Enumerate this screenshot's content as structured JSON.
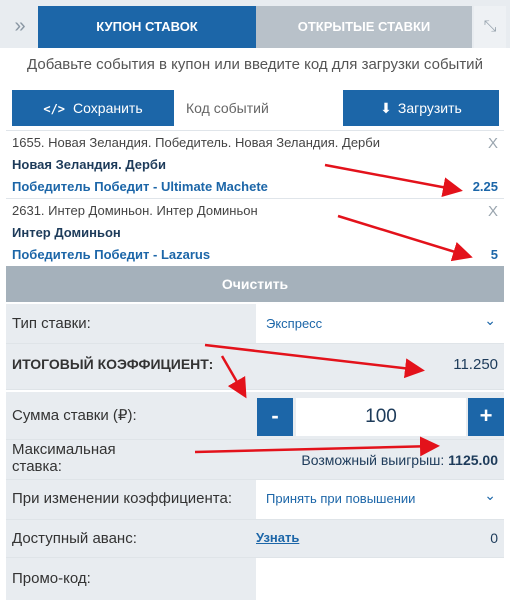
{
  "tabs": {
    "collapse_icon": "»",
    "coupon": "КУПОН СТАВОК",
    "open_bets": "ОТКРЫТЫЕ СТАВКИ",
    "expand_icon": "⤡"
  },
  "hint": "Добавьте события в купон или введите код для загрузки событий",
  "actions": {
    "save_icon": "</>",
    "save": "Сохранить",
    "code_placeholder": "Код событий",
    "load_icon": "⬇",
    "load": "Загрузить"
  },
  "bets": [
    {
      "event": "1655. Новая Зеландия. Победитель. Новая Зеландия. Дерби",
      "market": "Новая Зеландия. Дерби",
      "outcome": "Победитель Победит - Ultimate Machete",
      "odd": "2.25"
    },
    {
      "event": "2631. Интер Доминьон. Интер Доминьон",
      "market": "Интер Доминьон",
      "outcome": "Победитель Победит - Lazarus",
      "odd": "5"
    }
  ],
  "close_icon": "X",
  "clear": "Очистить",
  "form": {
    "bet_type_label": "Тип ставки:",
    "bet_type_value": "Экспресс",
    "total_label": "ИТОГОВЫЙ КОЭФФИЦИЕНТ:",
    "total_value": "11.250",
    "sum_label": "Сумма ставки (₽):",
    "minus": "-",
    "sum_value": "100",
    "plus": "+",
    "max_label_1": "Максимальная",
    "max_label_2": "ставка:",
    "win_label": "Возможный выигрыш:",
    "win_value": "1125.00",
    "change_label": "При изменении коэффициента:",
    "change_value": "Принять при повышении",
    "advance_label": "Доступный аванс:",
    "advance_link": "Узнать",
    "advance_value": "0",
    "promo_label": "Промо-код:"
  },
  "chevron_icon": "⌄",
  "annotation_color": "#e3121b"
}
